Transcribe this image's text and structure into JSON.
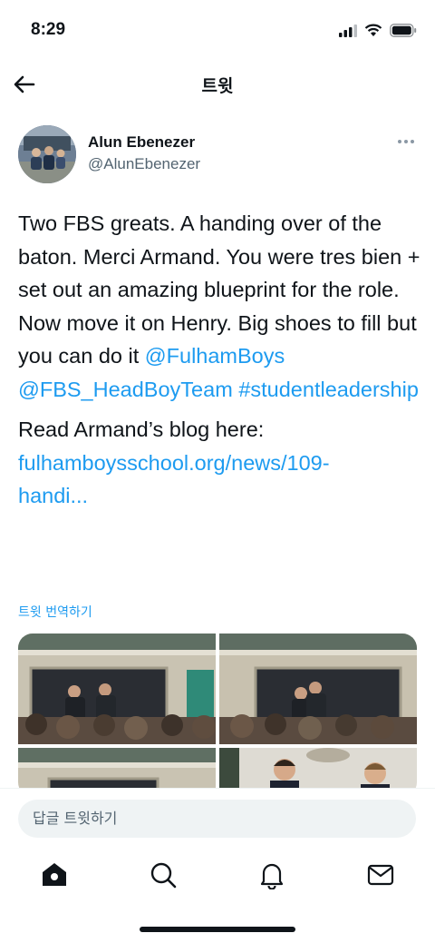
{
  "status_bar": {
    "time": "8:29"
  },
  "header": {
    "title": "트윗"
  },
  "tweet": {
    "author_name": "Alun Ebenezer",
    "author_handle": "@AlunEbenezer",
    "body": "Two FBS greats. A handing over of the baton. Merci Armand. You were tres bien + set out an amazing blueprint for the role. Now move it on Henry. Big shoes to fill but you can do it",
    "mention_1": "@FulhamBoys",
    "mention_2": "@FBS_HeadBoyTeam",
    "hashtag": "#studentleadership",
    "blog_prefix": "Read Armand’s blog here:",
    "link_line_1": "fulhamboysschool.org/news/109-",
    "link_line_2": "handi...",
    "translate_label": "트윗 번역하기"
  },
  "reply": {
    "placeholder": "답글 트윗하기"
  },
  "tabs": [
    "home-icon",
    "search-icon",
    "notifications-icon",
    "messages-icon"
  ],
  "colors": {
    "accent": "#1d9bf0",
    "text": "#0f1419",
    "secondary": "#536471"
  }
}
